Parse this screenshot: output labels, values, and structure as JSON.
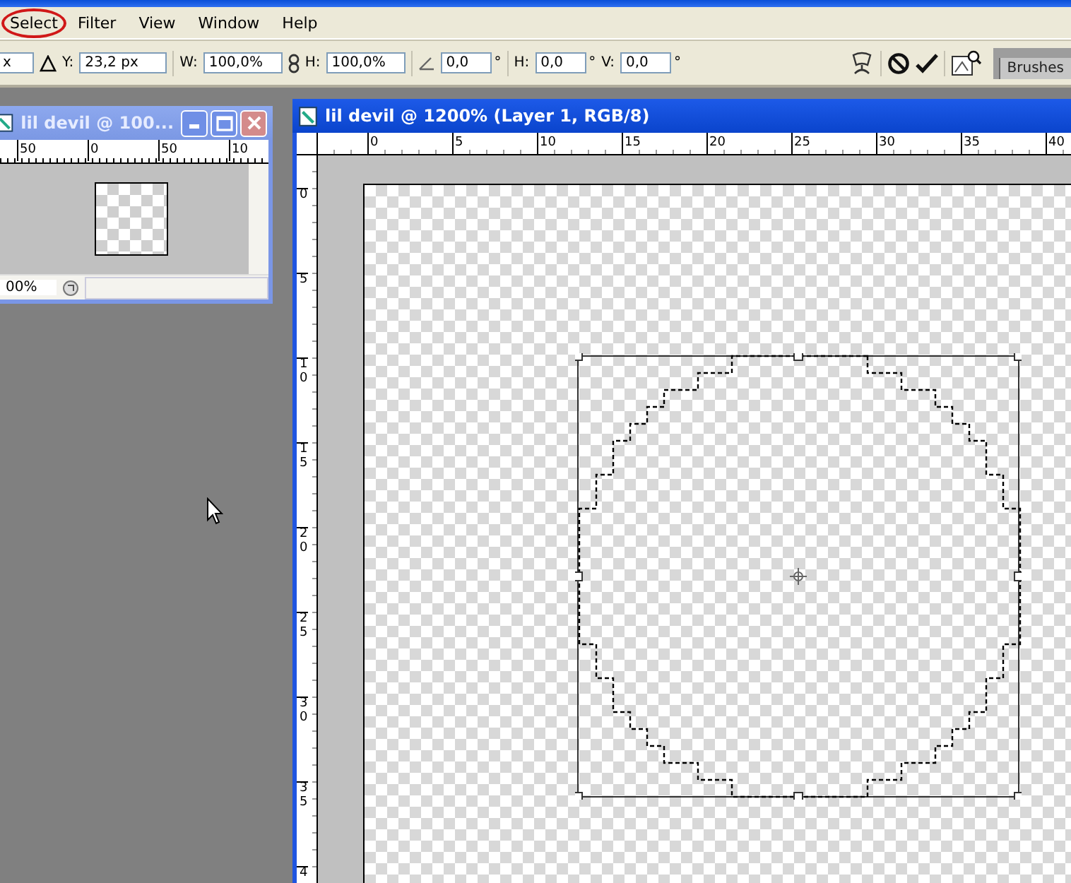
{
  "menu_bar": {
    "items": [
      {
        "label": "Select",
        "circled": true
      },
      {
        "label": "Filter",
        "circled": false
      },
      {
        "label": "View",
        "circled": false
      },
      {
        "label": "Window",
        "circled": false
      },
      {
        "label": "Help",
        "circled": false
      }
    ]
  },
  "options_bar": {
    "x_value": "x",
    "y_label": "Y:",
    "y_value": "23,2 px",
    "w_label": "W:",
    "w_value": "100,0%",
    "h_label": "H:",
    "h_value": "100,0%",
    "rotate_value": "0,0",
    "rotate_unit": "°",
    "hskew_label": "H:",
    "hskew_value": "0,0",
    "hskew_unit": "°",
    "vskew_label": "V:",
    "vskew_value": "0,0",
    "vskew_unit": "°"
  },
  "palette_well": {
    "tabs": [
      "Brushes"
    ]
  },
  "small_window": {
    "title": "lil devil @ 100...",
    "active": false,
    "ruler_labels": [
      "50",
      "0",
      "50",
      "10"
    ],
    "zoom_value": "00%"
  },
  "main_window": {
    "title": "lil devil @ 1200% (Layer 1, RGB/8)",
    "active": true,
    "h_ruler": [
      "0",
      "5",
      "10",
      "15",
      "20",
      "25",
      "30",
      "35",
      "40"
    ],
    "v_ruler": [
      "0",
      "5",
      "10",
      "15",
      "20",
      "25",
      "30",
      "35",
      "4"
    ]
  }
}
